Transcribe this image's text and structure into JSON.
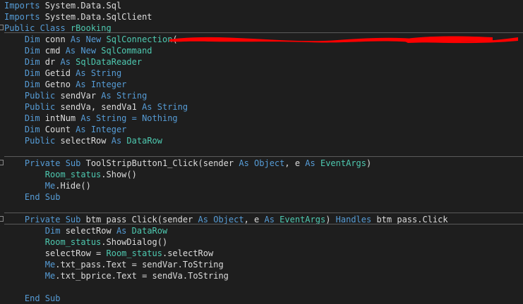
{
  "editor": {
    "lines": [
      [
        {
          "t": "Imports",
          "c": "kw"
        },
        {
          "t": " System.Data.Sql",
          "c": "tx"
        }
      ],
      [
        {
          "t": "Imports",
          "c": "kw"
        },
        {
          "t": " System.Data.SqlClient",
          "c": "tx"
        }
      ],
      [
        {
          "t": "Public Class ",
          "c": "kw"
        },
        {
          "t": "rBooking",
          "c": "ty"
        }
      ],
      [
        {
          "t": "    Dim ",
          "c": "kw"
        },
        {
          "t": "conn ",
          "c": "tx"
        },
        {
          "t": "As New ",
          "c": "kw"
        },
        {
          "t": "SqlConnection",
          "c": "ty"
        },
        {
          "t": "(",
          "c": "tx"
        }
      ],
      [
        {
          "t": "    Dim ",
          "c": "kw"
        },
        {
          "t": "cmd ",
          "c": "tx"
        },
        {
          "t": "As New ",
          "c": "kw"
        },
        {
          "t": "SqlCommand",
          "c": "ty"
        }
      ],
      [
        {
          "t": "    Dim ",
          "c": "kw"
        },
        {
          "t": "dr ",
          "c": "tx"
        },
        {
          "t": "As ",
          "c": "kw"
        },
        {
          "t": "SqlDataReader",
          "c": "ty"
        }
      ],
      [
        {
          "t": "    Dim ",
          "c": "kw"
        },
        {
          "t": "Getid ",
          "c": "tx"
        },
        {
          "t": "As String",
          "c": "kw"
        }
      ],
      [
        {
          "t": "    Dim ",
          "c": "kw"
        },
        {
          "t": "Getno ",
          "c": "tx"
        },
        {
          "t": "As Integer",
          "c": "kw"
        }
      ],
      [
        {
          "t": "    Public ",
          "c": "kw"
        },
        {
          "t": "sendVar ",
          "c": "tx"
        },
        {
          "t": "As String",
          "c": "kw"
        }
      ],
      [
        {
          "t": "    Public ",
          "c": "kw"
        },
        {
          "t": "sendVa, sendVa1 ",
          "c": "tx"
        },
        {
          "t": "As String",
          "c": "kw"
        }
      ],
      [
        {
          "t": "    Dim ",
          "c": "kw"
        },
        {
          "t": "intNum ",
          "c": "tx"
        },
        {
          "t": "As String = Nothing",
          "c": "kw"
        }
      ],
      [
        {
          "t": "    Dim ",
          "c": "kw"
        },
        {
          "t": "Count ",
          "c": "tx"
        },
        {
          "t": "As Integer",
          "c": "kw"
        }
      ],
      [
        {
          "t": "    Public ",
          "c": "kw"
        },
        {
          "t": "selectRow ",
          "c": "tx"
        },
        {
          "t": "As ",
          "c": "kw"
        },
        {
          "t": "DataRow",
          "c": "ty"
        }
      ],
      [],
      [
        {
          "t": "    Private Sub ",
          "c": "kw"
        },
        {
          "t": "ToolStripButton1_Click(sender ",
          "c": "tx"
        },
        {
          "t": "As Object",
          "c": "kw"
        },
        {
          "t": ", e ",
          "c": "tx"
        },
        {
          "t": "As ",
          "c": "kw"
        },
        {
          "t": "EventArgs",
          "c": "ty"
        },
        {
          "t": ")",
          "c": "tx"
        }
      ],
      [
        {
          "t": "        ",
          "c": "tx"
        },
        {
          "t": "Room_status",
          "c": "ty"
        },
        {
          "t": ".Show()",
          "c": "tx"
        }
      ],
      [
        {
          "t": "        Me",
          "c": "kw"
        },
        {
          "t": ".Hide()",
          "c": "tx"
        }
      ],
      [
        {
          "t": "    End Sub",
          "c": "kw"
        }
      ],
      [],
      [
        {
          "t": "    Private Sub ",
          "c": "kw"
        },
        {
          "t": "btm_pass_Click(sender ",
          "c": "tx"
        },
        {
          "t": "As Object",
          "c": "kw"
        },
        {
          "t": ", e ",
          "c": "tx"
        },
        {
          "t": "As ",
          "c": "kw"
        },
        {
          "t": "EventArgs",
          "c": "ty"
        },
        {
          "t": ") ",
          "c": "tx"
        },
        {
          "t": "Handles ",
          "c": "kw"
        },
        {
          "t": "btm_pass.Click",
          "c": "tx"
        }
      ],
      [
        {
          "t": "        Dim ",
          "c": "kw"
        },
        {
          "t": "selectRow ",
          "c": "tx"
        },
        {
          "t": "As ",
          "c": "kw"
        },
        {
          "t": "DataRow",
          "c": "ty"
        }
      ],
      [
        {
          "t": "        ",
          "c": "tx"
        },
        {
          "t": "Room_status",
          "c": "ty"
        },
        {
          "t": ".ShowDialog()",
          "c": "tx"
        }
      ],
      [
        {
          "t": "        selectRow = ",
          "c": "tx"
        },
        {
          "t": "Room_status",
          "c": "ty"
        },
        {
          "t": ".selectRow",
          "c": "tx"
        }
      ],
      [
        {
          "t": "        Me",
          "c": "kw"
        },
        {
          "t": ".txt_pass.Text = sendVar.ToString",
          "c": "tx"
        }
      ],
      [
        {
          "t": "        Me",
          "c": "kw"
        },
        {
          "t": ".txt_bprice.Text = sendVa.ToString",
          "c": "tx"
        }
      ],
      [],
      [
        {
          "t": "    End Sub",
          "c": "kw"
        }
      ]
    ],
    "fold_lines": [
      2,
      14,
      19
    ],
    "separators_after": [
      1,
      12,
      17,
      18
    ],
    "colors": {
      "keyword": "#569cd6",
      "type": "#4ec9b0",
      "text": "#dcdcdc",
      "background": "#1e1e1e",
      "redaction": "#ff0000"
    }
  }
}
